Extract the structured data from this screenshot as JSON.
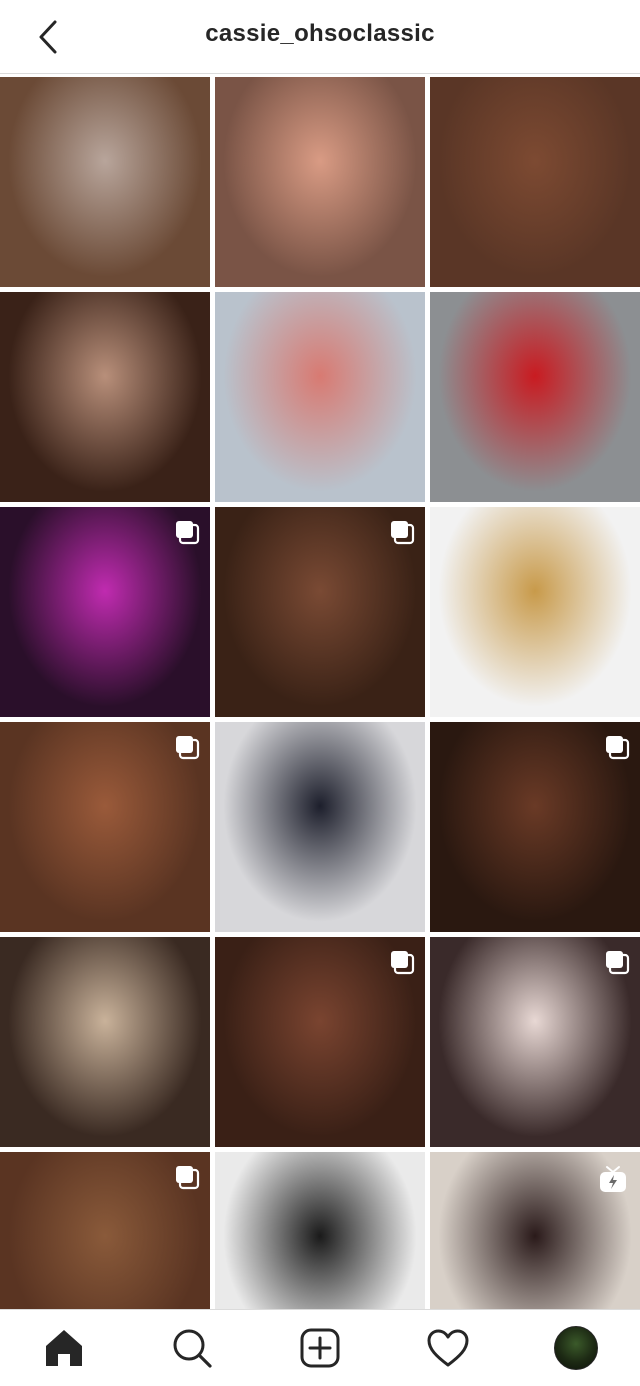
{
  "header": {
    "username": "cassie_ohsoclassic",
    "back_icon": "chevron-left-icon"
  },
  "grid": {
    "columns": 3,
    "posts": [
      {
        "row": 1,
        "col": 1,
        "type": "photo",
        "colors": [
          "#6b4a36",
          "#b8a59b",
          "#2a1b16"
        ]
      },
      {
        "row": 1,
        "col": 2,
        "type": "photo",
        "colors": [
          "#7a5446",
          "#d99b84",
          "#3a8fa0"
        ]
      },
      {
        "row": 1,
        "col": 3,
        "type": "photo",
        "colors": [
          "#5a3626",
          "#7d4a32",
          "#a86a4d"
        ]
      },
      {
        "row": 2,
        "col": 1,
        "type": "photo",
        "colors": [
          "#3a2218",
          "#b88f7a",
          "#121010"
        ]
      },
      {
        "row": 2,
        "col": 2,
        "type": "photo",
        "colors": [
          "#b9c2cc",
          "#d87a72",
          "#e7e0d8"
        ]
      },
      {
        "row": 2,
        "col": 3,
        "type": "photo",
        "colors": [
          "#8c8f92",
          "#c91b21",
          "#5a4634"
        ]
      },
      {
        "row": 3,
        "col": 1,
        "type": "carousel",
        "colors": [
          "#2a0f2a",
          "#c02bb0",
          "#7a2a90"
        ]
      },
      {
        "row": 3,
        "col": 2,
        "type": "carousel",
        "colors": [
          "#3a2216",
          "#7a4a34",
          "#2b8a8c"
        ]
      },
      {
        "row": 3,
        "col": 3,
        "type": "photo",
        "colors": [
          "#f2f2f2",
          "#c89a4a",
          "#6a4a2a"
        ]
      },
      {
        "row": 4,
        "col": 1,
        "type": "carousel",
        "colors": [
          "#5a3422",
          "#9a5a3a",
          "#c88a5a"
        ]
      },
      {
        "row": 4,
        "col": 2,
        "type": "photo",
        "colors": [
          "#d7d7da",
          "#1d1f2c",
          "#6a4a3a"
        ]
      },
      {
        "row": 4,
        "col": 3,
        "type": "carousel",
        "colors": [
          "#2a1810",
          "#6a3a26",
          "#a0623e"
        ]
      },
      {
        "row": 5,
        "col": 1,
        "type": "photo",
        "colors": [
          "#3a2a22",
          "#c9b29a",
          "#8a6a50"
        ]
      },
      {
        "row": 5,
        "col": 2,
        "type": "carousel",
        "colors": [
          "#3a2016",
          "#7a4430",
          "#e0603a"
        ]
      },
      {
        "row": 5,
        "col": 3,
        "type": "carousel",
        "colors": [
          "#3a2a2a",
          "#e8d8d4",
          "#c86a70"
        ]
      },
      {
        "row": 6,
        "col": 1,
        "type": "carousel",
        "colors": [
          "#5a3422",
          "#8a5a3a",
          "#c08860"
        ]
      },
      {
        "row": 6,
        "col": 2,
        "type": "photo",
        "colors": [
          "#eaeaea",
          "#1a1a1a",
          "#7a4a34"
        ]
      },
      {
        "row": 6,
        "col": 3,
        "type": "igtv",
        "colors": [
          "#d8d0c8",
          "#2a1a1a",
          "#8a5a40"
        ]
      },
      {
        "row": 7,
        "col": 1,
        "type": "photo",
        "colors": [
          "#d8d4d0",
          "#c8a08a",
          "#e8e4e0"
        ]
      },
      {
        "row": 7,
        "col": 2,
        "type": "photo",
        "colors": [
          "#5a3428",
          "#c86a6a",
          "#3a2018"
        ]
      },
      {
        "row": 7,
        "col": 3,
        "type": "photo",
        "colors": [
          "#c8a08a",
          "#a04838",
          "#e0b8a0"
        ]
      }
    ]
  },
  "bottom_nav": {
    "items": [
      {
        "name": "home",
        "icon": "home-icon",
        "active": true
      },
      {
        "name": "search",
        "icon": "search-icon",
        "active": false
      },
      {
        "name": "new-post",
        "icon": "add-post-icon",
        "active": false
      },
      {
        "name": "activity",
        "icon": "heart-icon",
        "active": false
      },
      {
        "name": "profile",
        "icon": "avatar",
        "active": false
      }
    ]
  },
  "colors": {
    "text": "#262626",
    "divider": "#dbdbdb",
    "background": "#ffffff"
  }
}
